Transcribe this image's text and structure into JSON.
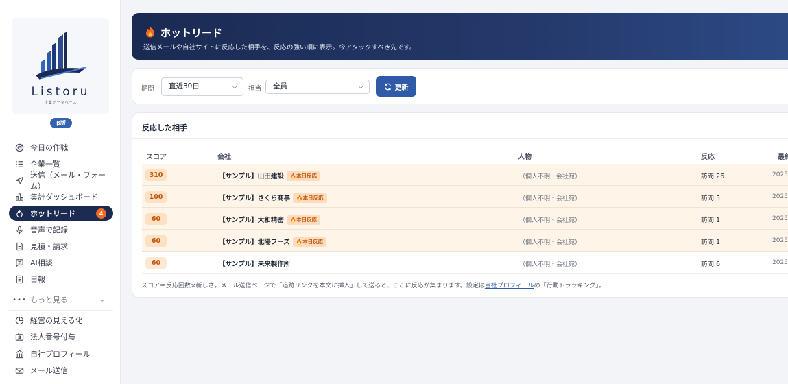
{
  "sidebar": {
    "logo_text": "Listoru",
    "logo_sub": "企業データベース",
    "beta": "β版",
    "items": [
      {
        "label": "今日の作戦",
        "icon": "target-icon"
      },
      {
        "label": "企業一覧",
        "icon": "list-icon"
      },
      {
        "label": "送信（メール・フォーム）",
        "icon": "send-icon"
      },
      {
        "label": "集計ダッシュボード",
        "icon": "bar-chart-icon"
      },
      {
        "label": "ホットリード",
        "icon": "flame-icon",
        "count": "4",
        "active": true
      },
      {
        "label": "音声で記録",
        "icon": "microphone-icon"
      },
      {
        "label": "見積・請求",
        "icon": "document-icon"
      },
      {
        "label": "AI相談",
        "icon": "chat-icon"
      },
      {
        "label": "日報",
        "icon": "report-icon"
      }
    ],
    "more_label": "もっと見る",
    "extra_items": [
      {
        "label": "経営の見える化",
        "icon": "pie-chart-icon"
      },
      {
        "label": "法人番号付与",
        "icon": "id-card-icon"
      },
      {
        "label": "自社プロフィール",
        "icon": "building-icon"
      },
      {
        "label": "メール送信",
        "icon": "mail-icon"
      }
    ]
  },
  "header": {
    "title": "ホットリード",
    "subtitle": "送信メールや自社サイトに反応した相手を、反応の強い順に表示。今アタックすべき先です。"
  },
  "filters": {
    "period_label": "期間",
    "period_value": "直近30日",
    "owner_label": "担当",
    "owner_value": "全員",
    "refresh_label": "更新"
  },
  "table": {
    "title": "反応した相手",
    "columns": [
      "スコア",
      "会社",
      "人物",
      "反応",
      "最終"
    ],
    "rows": [
      {
        "score": "310",
        "company": "【サンプル】山田建設",
        "tag": "本日反応",
        "person": "（個人不明・会社宛）",
        "reaction": "訪問 26",
        "last": "2025",
        "hot": true
      },
      {
        "score": "100",
        "company": "【サンプル】さくら商事",
        "tag": "本日反応",
        "person": "（個人不明・会社宛）",
        "reaction": "訪問 5",
        "last": "2025",
        "hot": true
      },
      {
        "score": "60",
        "company": "【サンプル】大和精密",
        "tag": "本日反応",
        "person": "（個人不明・会社宛）",
        "reaction": "訪問 1",
        "last": "2025",
        "hot": true
      },
      {
        "score": "60",
        "company": "【サンプル】北陽フーズ",
        "tag": "本日反応",
        "person": "（個人不明・会社宛）",
        "reaction": "訪問 1",
        "last": "2025",
        "hot": true
      },
      {
        "score": "60",
        "company": "【サンプル】未来製作所",
        "tag": "",
        "person": "（個人不明・会社宛）",
        "reaction": "訪問 6",
        "last": "2025",
        "hot": false
      }
    ],
    "note_before": "スコア＝反応回数×新しさ。メール送信ページで「追跡リンクを本文に挿入」して送ると、ここに反応が集まります。設定は",
    "note_link": "自社プロフィール",
    "note_after": "の「行動トラッキング」。"
  },
  "colors": {
    "navy": "#1b2b52",
    "accent_blue": "#2f5aa8",
    "hot_orange": "#f26a21",
    "hot_row_bg": "#fff4e8"
  }
}
